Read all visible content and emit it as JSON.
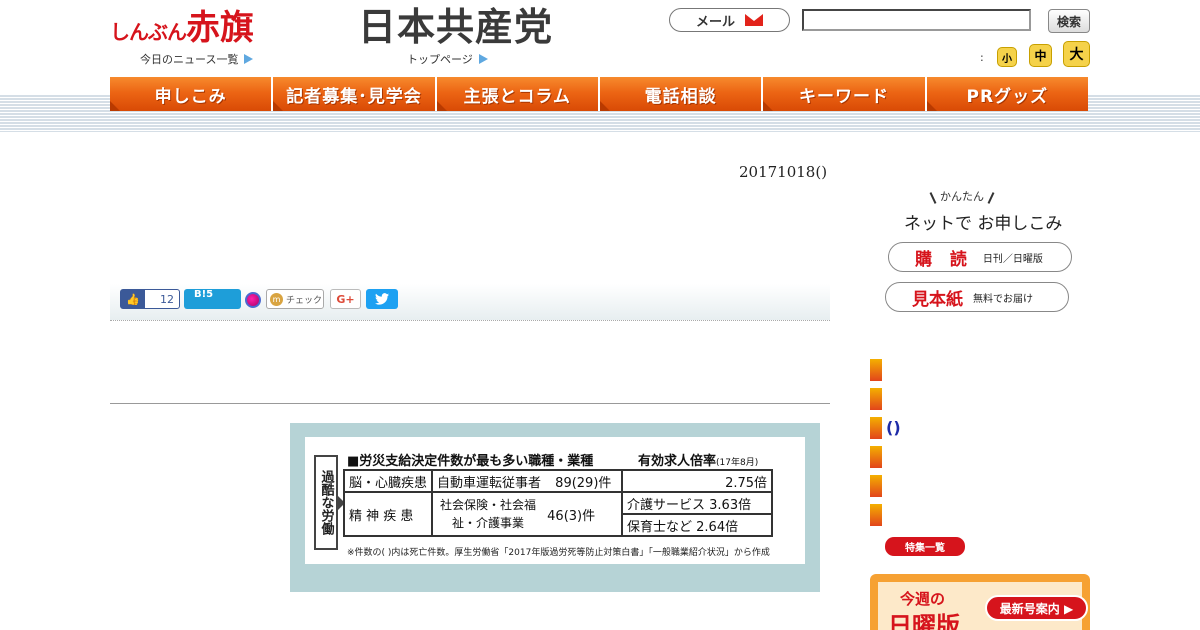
{
  "header": {
    "logo_akahata_small": "しんぶん",
    "logo_akahata_big": "赤旗",
    "today_news_link": "今日のニュース一覧",
    "logo_jcp": "日本共産党",
    "top_page_link": "トップページ",
    "mail_label": "メール",
    "search_value": "",
    "search_button": "検索",
    "font_colon": ":",
    "font_small": "小",
    "font_medium": "中",
    "font_large": "大"
  },
  "nav": {
    "items": [
      "申しこみ",
      "記者募集･見学会",
      "主張とコラム",
      "電話相談",
      "キーワード",
      "PRグッズ"
    ]
  },
  "article": {
    "date": "20171018()"
  },
  "share": {
    "fb_count": "12",
    "hatena_label": "B!5",
    "check_label": "チェック",
    "gplus_label": "G+"
  },
  "figure": {
    "side_label": "過酷な労働",
    "title_left": "■労災支給決定件数が最も多い職種・業種",
    "title_right": "有効求人倍率",
    "title_right_note": "(17年8月)",
    "row1": {
      "category": "脳・心臓疾患",
      "industry": "自動車運転従事者",
      "count": "89(29)件",
      "ratio": "2.75倍"
    },
    "row2": {
      "category": "精 神 疾 患",
      "industry": "社会保険・社会福祉・介護事業",
      "count": "46(3)件",
      "ratio_a": "介護サービス 3.63倍",
      "ratio_b": "保育士など 2.64倍"
    },
    "note": "※件数の( )内は死亡件数。厚生労働省「2017年版過労死等防止対策白書」「一般職業紹介状況」から作成"
  },
  "sidebar": {
    "kantan": "かんたん",
    "net_title": "ネットで お申しこみ",
    "subscribe_main": "購 読",
    "subscribe_sub": "日刊／日曜版",
    "sample_main": "見本紙",
    "sample_sub": "無料でお届け",
    "paren_text": "()",
    "tokushu": "特集一覧",
    "promo_t1": "今週の",
    "promo_t2": "日曜版",
    "promo_latest": "最新号案内 ▶"
  },
  "colors": {
    "brand_red": "#d6141c",
    "nav_orange": "#ec6514",
    "fb_blue": "#3b5998",
    "twitter_blue": "#1da1f2"
  }
}
